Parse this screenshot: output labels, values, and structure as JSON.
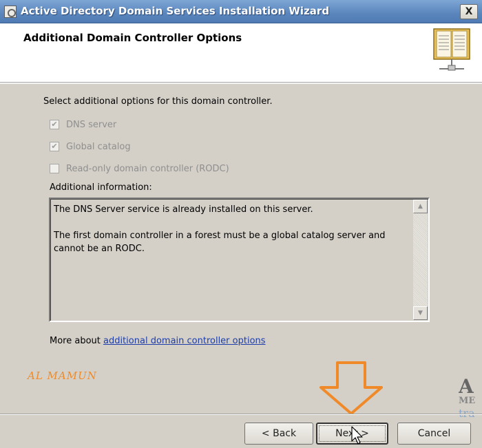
{
  "window": {
    "title": "Active Directory Domain Services Installation Wizard",
    "close_glyph": "X",
    "title_icon": "wizard-window-icon"
  },
  "header": {
    "title": "Additional Domain Controller Options",
    "icon": "directory-book-icon"
  },
  "body": {
    "intro": "Select additional options for this domain controller.",
    "options": [
      {
        "label": "DNS server",
        "checked": true,
        "enabled": false
      },
      {
        "label": "Global catalog",
        "checked": true,
        "enabled": false
      },
      {
        "label": "Read-only domain controller (RODC)",
        "checked": false,
        "enabled": false
      }
    ],
    "info_label": "Additional information:",
    "info_text": "The DNS Server service is already installed on this server.\n\nThe first domain controller in a forest must be a global catalog server and\ncannot be an RODC.",
    "more_prefix": "More about ",
    "more_link": "additional domain controller options"
  },
  "overlay": {
    "watermark": "AL MAMUN",
    "logo_lines": [
      "A",
      "ME",
      "tra"
    ],
    "arrow_color": "#f08a28",
    "arrow_icon": "down-arrow-annotation"
  },
  "buttons": {
    "back": "< Back",
    "next": "Next >",
    "cancel": "Cancel"
  },
  "colors": {
    "title_bar": "#5a86bd",
    "dialog_bg": "#d4d0c8",
    "link": "#1d3da8",
    "watermark": "#f08a28"
  }
}
